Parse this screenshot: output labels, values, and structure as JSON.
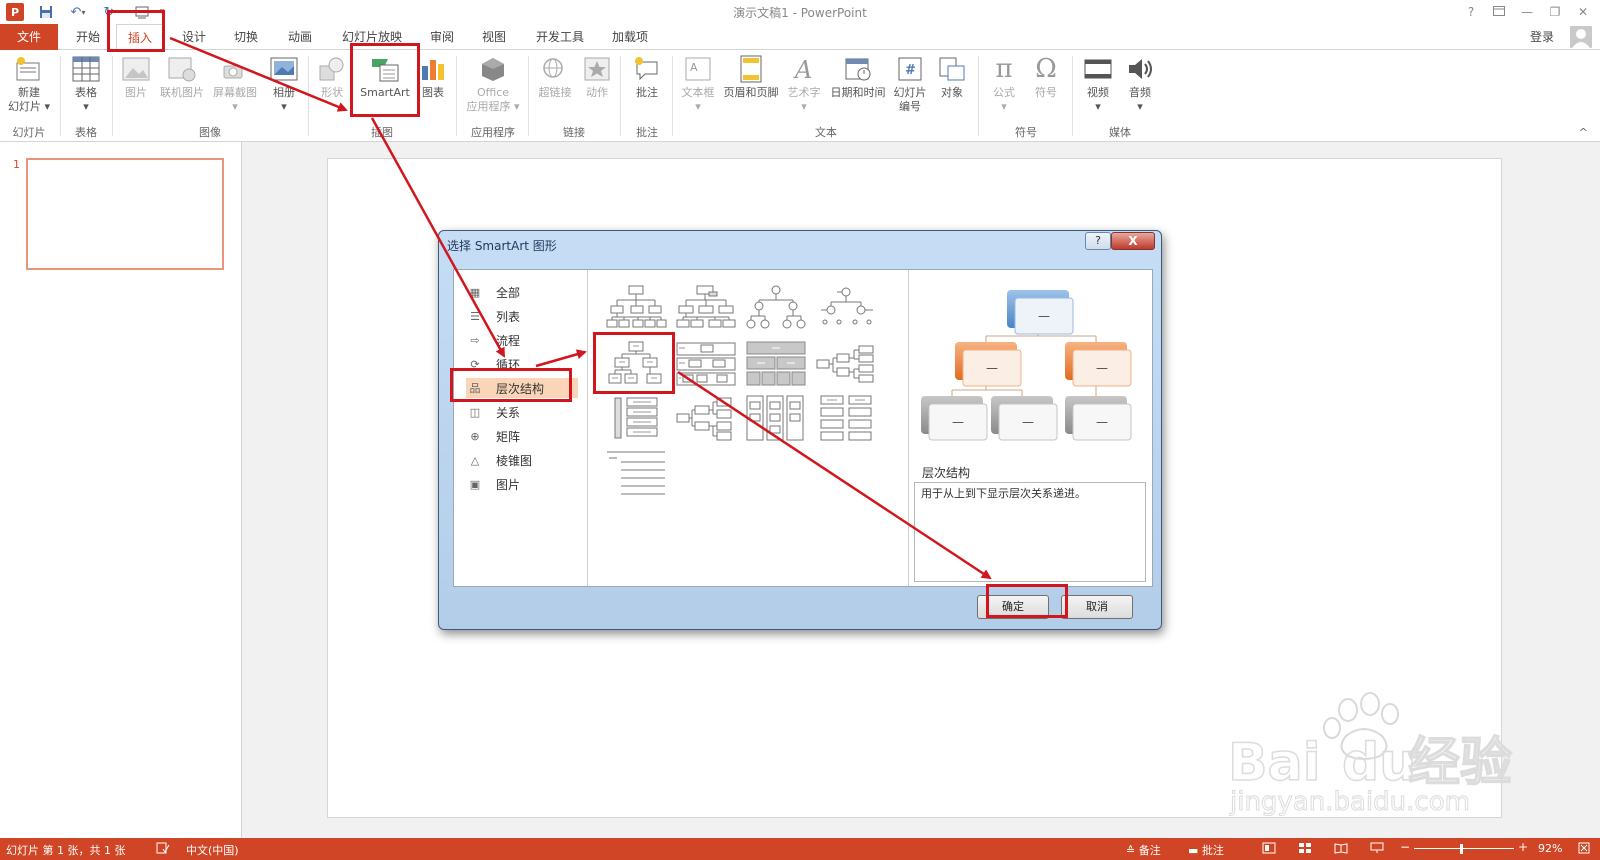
{
  "window": {
    "title": "演示文稿1 - PowerPoint",
    "logo": "P",
    "login": "登录"
  },
  "qat": {
    "save_icon": "save-icon",
    "undo_icon": "undo-icon",
    "redo_icon": "redo-icon",
    "customize_icon": "customize-icon"
  },
  "tabs": [
    {
      "label": "文件"
    },
    {
      "label": "开始"
    },
    {
      "label": "插入"
    },
    {
      "label": "设计"
    },
    {
      "label": "切换"
    },
    {
      "label": "动画"
    },
    {
      "label": "幻灯片放映"
    },
    {
      "label": "审阅"
    },
    {
      "label": "视图"
    },
    {
      "label": "开发工具"
    },
    {
      "label": "加载项"
    }
  ],
  "ribbon": {
    "buttons": [
      {
        "l1": "新建",
        "l2": "幻灯片 ▾"
      },
      {
        "l1": "表格",
        "l2": "▾"
      },
      {
        "l1": "图片",
        "l2": ""
      },
      {
        "l1": "联机图片",
        "l2": ""
      },
      {
        "l1": "屏幕截图",
        "l2": "▾"
      },
      {
        "l1": "相册",
        "l2": "▾"
      },
      {
        "l1": "形状",
        "l2": ""
      },
      {
        "l1": "SmartArt",
        "l2": ""
      },
      {
        "l1": "图表",
        "l2": ""
      },
      {
        "l1": "Office",
        "l2": "应用程序 ▾"
      },
      {
        "l1": "超链接",
        "l2": ""
      },
      {
        "l1": "动作",
        "l2": ""
      },
      {
        "l1": "批注",
        "l2": ""
      },
      {
        "l1": "文本框",
        "l2": "▾"
      },
      {
        "l1": "页眉和页脚",
        "l2": ""
      },
      {
        "l1": "艺术字",
        "l2": "▾"
      },
      {
        "l1": "日期和时间",
        "l2": ""
      },
      {
        "l1": "幻灯片",
        "l2": "编号"
      },
      {
        "l1": "对象",
        "l2": ""
      },
      {
        "l1": "公式",
        "l2": "▾"
      },
      {
        "l1": "符号",
        "l2": ""
      },
      {
        "l1": "视频",
        "l2": "▾"
      },
      {
        "l1": "音频",
        "l2": "▾"
      }
    ],
    "groups": [
      "幻灯片",
      "表格",
      "图像",
      "插图",
      "应用程序",
      "链接",
      "批注",
      "文本",
      "符号",
      "媒体"
    ],
    "collapse": "^"
  },
  "thumbnails": {
    "slide_number": "1"
  },
  "dialog": {
    "title": "选择 SmartArt 图形",
    "help": "?",
    "close": "X",
    "categories": [
      "全部",
      "列表",
      "流程",
      "循环",
      "层次结构",
      "关系",
      "矩阵",
      "棱锥图",
      "图片"
    ],
    "selected_category": "层次结构",
    "preview": {
      "name": "层次结构",
      "description": "用于从上到下显示层次关系递进。",
      "dash": "—"
    },
    "ok": "确定",
    "cancel": "取消"
  },
  "status": {
    "slide_info": "幻灯片 第 1 张，共 1 张",
    "language": "中文(中国)",
    "notes": "备注",
    "comments": "批注",
    "zoom": "92%",
    "zoom_minus": "−",
    "zoom_plus": "+"
  },
  "watermark": {
    "text1": "Bai",
    "text2": "du",
    "text3": "经验",
    "url": "jingyan.baidu.com"
  },
  "colors": {
    "accent": "#d04525",
    "highlight": "#d2161e",
    "preview_blue": "#5b9bd5",
    "preview_orange": "#ed7d31",
    "preview_gray": "#a5a5a5"
  }
}
